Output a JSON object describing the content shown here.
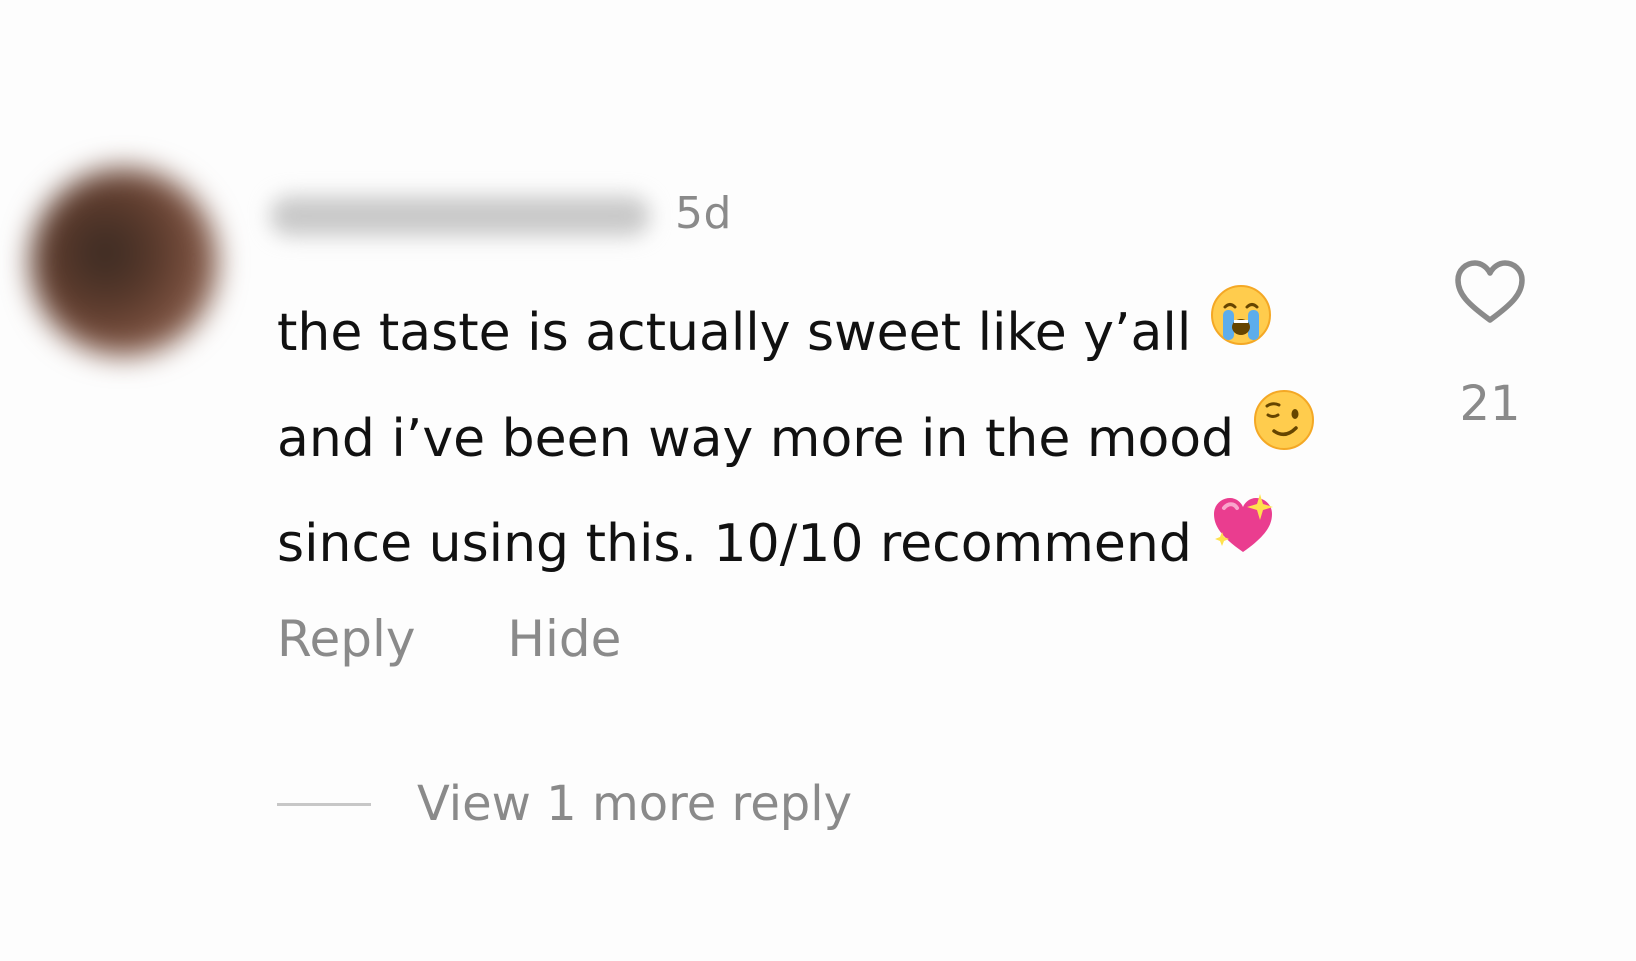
{
  "comment": {
    "timestamp": "5d",
    "lines": [
      {
        "text": "the taste is actually sweet like y’all",
        "emoji": "loudly-crying-face"
      },
      {
        "text": "and i’ve been way more in the mood",
        "emoji": "winking-face"
      },
      {
        "text": "since using this. 10/10 recommend",
        "emoji": "sparkling-heart"
      }
    ],
    "like_icon": "heart-outline-icon",
    "like_count": "21",
    "actions": {
      "reply": "Reply",
      "hide": "Hide"
    },
    "view_replies": "View 1 more reply"
  }
}
